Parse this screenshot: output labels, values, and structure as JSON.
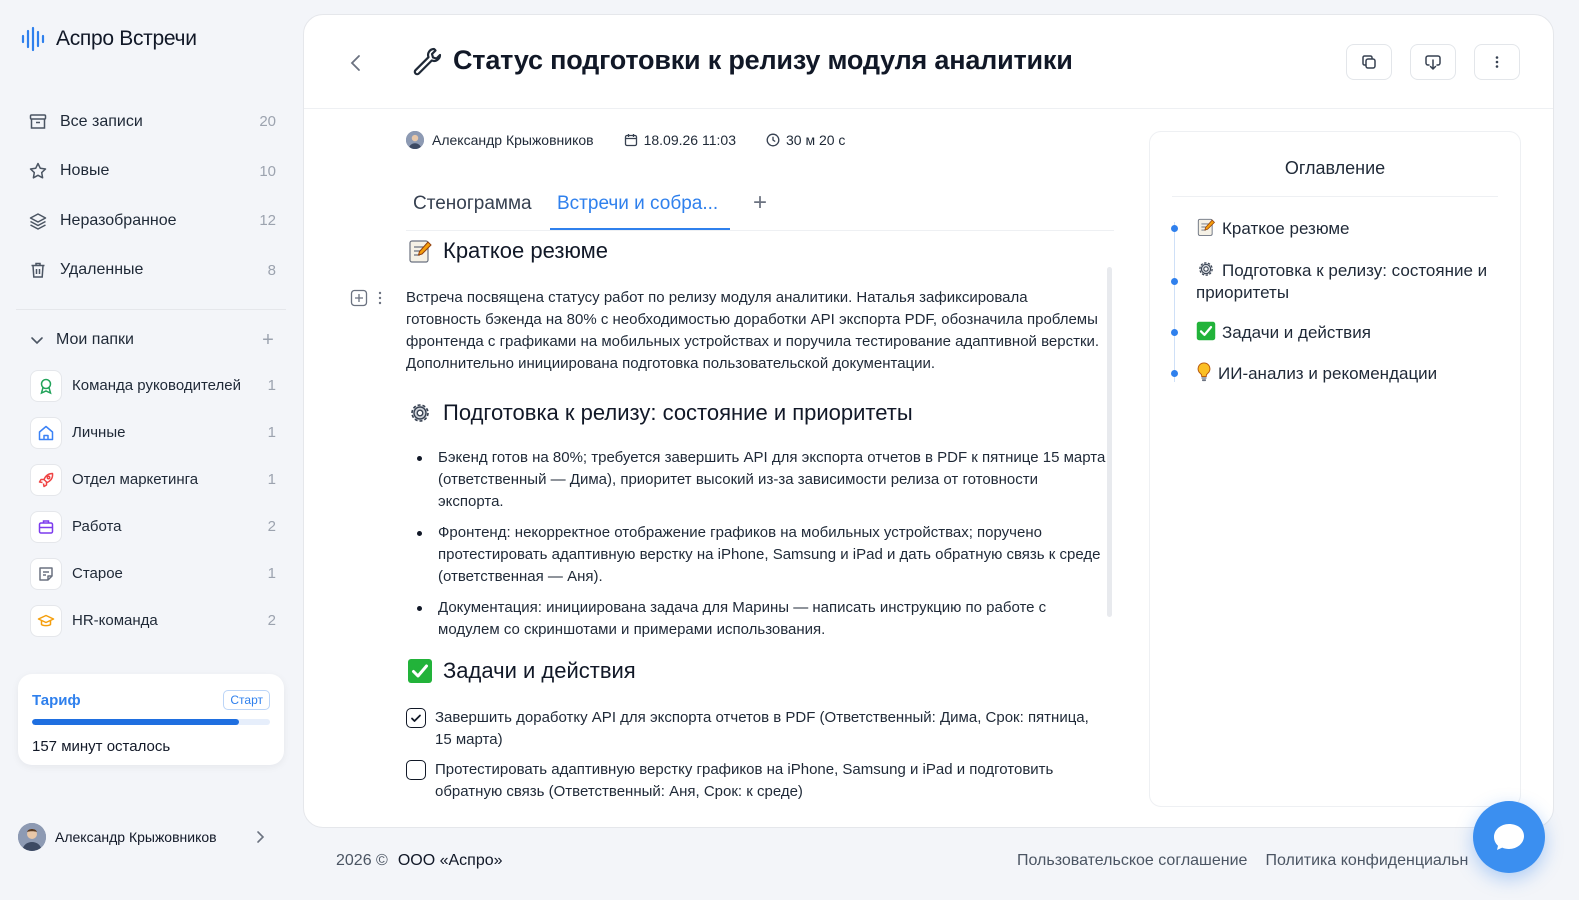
{
  "app": {
    "name": "Аспро Встречи"
  },
  "sidebar": {
    "nav": [
      {
        "label": "Все записи",
        "count": "20",
        "icon": "archive-icon"
      },
      {
        "label": "Новые",
        "count": "10",
        "icon": "star-icon"
      },
      {
        "label": "Неразобранное",
        "count": "12",
        "icon": "layers-icon"
      },
      {
        "label": "Удаленные",
        "count": "8",
        "icon": "trash-icon"
      }
    ],
    "folders_title": "Мои папки",
    "folders": [
      {
        "label": "Команда руководителей",
        "count": "1",
        "icon": "award-icon",
        "color": "#22a35a"
      },
      {
        "label": "Личные",
        "count": "1",
        "icon": "home-icon",
        "color": "#3b82f6"
      },
      {
        "label": "Отдел маркетинга",
        "count": "1",
        "icon": "rocket-icon",
        "color": "#ef4444"
      },
      {
        "label": "Работа",
        "count": "2",
        "icon": "briefcase-icon",
        "color": "#7c3aed"
      },
      {
        "label": "Старое",
        "count": "1",
        "icon": "note-icon",
        "color": "#6b7280"
      },
      {
        "label": "HR-команда",
        "count": "2",
        "icon": "graduation-cap-icon",
        "color": "#f59e0b"
      }
    ],
    "tariff": {
      "title": "Тариф",
      "badge": "Старт",
      "remaining": "157 минут осталось",
      "progress": 0.87
    },
    "user": {
      "name": "Александр Крыжовников"
    }
  },
  "main": {
    "title": "Статус подготовки к релизу модуля аналитики",
    "meta": {
      "author": "Александр Крыжовников",
      "datetime": "18.09.26 11:03",
      "duration": "30 м 20 с"
    },
    "tabs": [
      {
        "label": "Стенограмма",
        "active": false
      },
      {
        "label": "Встречи и собра...",
        "active": true
      }
    ],
    "sections": {
      "summary": {
        "heading": "Краткое резюме",
        "text": "Встреча посвящена статусу работ по релизу модуля аналитики. Наталья зафиксировала готовность бэкенда на 80% с необходимостью доработки API экспорта PDF, обозначила проблемы фронтенда с графиками на мобильных устройствах и поручила тестирование адаптивной верстки. Дополнительно инициирована подготовка пользовательской документации."
      },
      "release": {
        "heading": "Подготовка к релизу: состояние и приоритеты",
        "bullets": [
          "Бэкенд готов на 80%; требуется завершить API для экспорта отчетов в PDF к пятнице 15 марта (ответственный — Дима), приоритет высокий из-за зависимости релиза от готовности экспорта.",
          "Фронтенд: некорректное отображение графиков на мобильных устройствах; поручено протестировать адаптивную верстку на iPhone, Samsung и iPad и дать обратную связь к среде (ответственная — Аня).",
          "Документация: инициирована задача для Марины — написать инструкцию по работе с модулем со скриншотами и примерами использования."
        ]
      },
      "tasks": {
        "heading": "Задачи и действия",
        "items": [
          {
            "text": "Завершить доработку API для экспорта отчетов в PDF (Ответственный: Дима, Срок: пятница, 15 марта)",
            "checked": true
          },
          {
            "text": "Протестировать адаптивную верстку графиков на iPhone, Samsung и iPad и подготовить обратную связь (Ответственный: Аня, Срок: к среде)",
            "checked": false
          }
        ]
      }
    },
    "toc": {
      "title": "Оглавление",
      "items": [
        {
          "label": "Краткое резюме",
          "icon": "memo-icon"
        },
        {
          "label": "Подготовка к релизу: состояние и приоритеты",
          "icon": "gear-icon"
        },
        {
          "label": "Задачи и действия",
          "icon": "check-mark-button-icon"
        },
        {
          "label": "ИИ-анализ и рекомендации",
          "icon": "light-bulb-icon"
        }
      ]
    }
  },
  "footer": {
    "copyright": "2026 ©",
    "company": "ООО «Аспро»",
    "links": [
      "Пользовательское соглашение",
      "Политика конфиденциальн"
    ]
  },
  "colors": {
    "accent": "#2f80ed",
    "check_green": "#22b33a"
  }
}
